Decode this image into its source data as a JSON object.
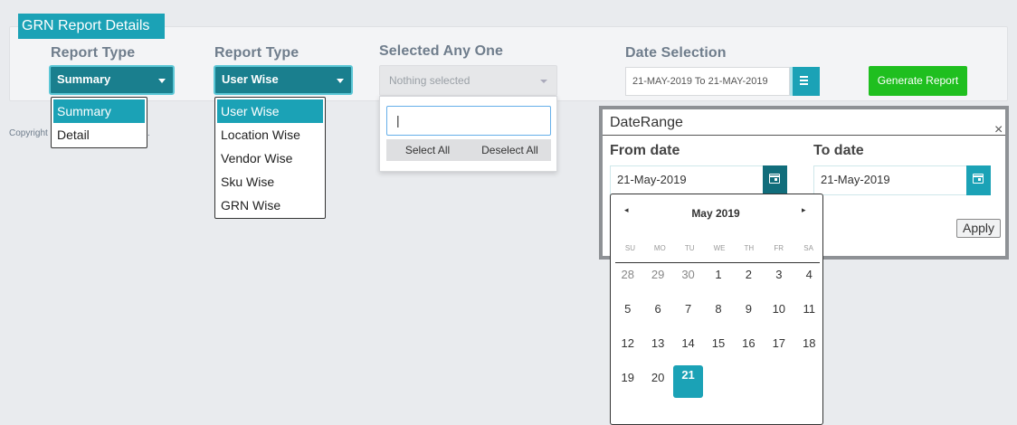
{
  "panel": {
    "title": "GRN Report Details"
  },
  "report_type_1": {
    "label": "Report Type",
    "selected": "Summary",
    "options": [
      "Summary",
      "Detail"
    ]
  },
  "report_type_2": {
    "label": "Report Type",
    "selected": "User Wise",
    "options": [
      "User Wise",
      "Location Wise",
      "Vendor Wise",
      "Sku Wise",
      "GRN Wise"
    ]
  },
  "selected_any_one": {
    "label": "Selected Any One",
    "placeholder": "Nothing selected",
    "search_value": "|",
    "select_all": "Select All",
    "deselect_all": "Deselect All"
  },
  "date_selection": {
    "label": "Date Selection",
    "value": "21-MAY-2019 To 21-MAY-2019"
  },
  "generate_button": "Generate Report",
  "copyright": "Copyright",
  "copyright_tail": ".",
  "date_range": {
    "title": "DateRange",
    "close": "×",
    "from_label": "From date",
    "from_value": "21-May-2019",
    "to_label": "To date",
    "to_value": "21-May-2019",
    "apply": "Apply"
  },
  "calendar": {
    "month": "May 2019",
    "prev": "◂",
    "next": "▸",
    "weekdays": [
      "SU",
      "MO",
      "TU",
      "WE",
      "TH",
      "FR",
      "SA"
    ],
    "weeks": [
      [
        "28",
        "29",
        "30",
        "1",
        "2",
        "3",
        "4"
      ],
      [
        "5",
        "6",
        "7",
        "8",
        "9",
        "10",
        "11"
      ],
      [
        "12",
        "13",
        "14",
        "15",
        "16",
        "17",
        "18"
      ],
      [
        "19",
        "20",
        "21",
        "",
        "",
        "",
        ""
      ]
    ],
    "muted_days": [
      "28",
      "29",
      "30"
    ],
    "selected_day": "21",
    "accent": "#1ba2b6"
  },
  "colors": {
    "accent": "#1ba2b6",
    "dark_teal": "#1a7f8e",
    "green": "#1fbf1f"
  }
}
